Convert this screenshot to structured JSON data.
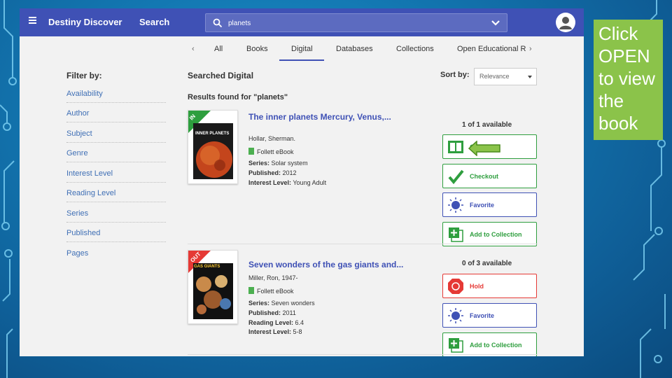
{
  "app": {
    "brand": "Destiny Discover",
    "nav_search": "Search",
    "search_value": "planets"
  },
  "tabs": [
    "All",
    "Books",
    "Digital",
    "Databases",
    "Collections",
    "Open Educational R"
  ],
  "active_tab": "Digital",
  "filter": {
    "title": "Filter by:",
    "items": [
      "Availability",
      "Author",
      "Subject",
      "Genre",
      "Interest Level",
      "Reading Level",
      "Series",
      "Published",
      "Pages"
    ]
  },
  "results": {
    "heading": "Searched Digital",
    "found": "Results found for \"planets\"",
    "sort_label": "Sort by:",
    "sort_value": "Relevance",
    "items": [
      {
        "badge": "IN",
        "cover_title": "INNER PLANETS",
        "title": "The inner planets Mercury, Venus,...",
        "author": "Hollar, Sherman.",
        "format": "Follett eBook",
        "series_label": "Series:",
        "series": "Solar system",
        "published_label": "Published:",
        "published": "2012",
        "interest_label": "Interest Level:",
        "interest": "Young Adult",
        "availability": "1 of 1 available",
        "actions": [
          "Open",
          "Checkout",
          "Favorite",
          "Add to Collection"
        ]
      },
      {
        "badge": "OUT",
        "cover_title": "GAS GIANTS",
        "title": "Seven wonders of the gas giants and...",
        "author": "Miller, Ron, 1947-",
        "format": "Follett eBook",
        "series_label": "Series:",
        "series": "Seven wonders",
        "published_label": "Published:",
        "published": "2011",
        "reading_label": "Reading Level:",
        "reading": "6.4",
        "interest_label": "Interest Level:",
        "interest": "5-8",
        "availability": "0 of 3 available",
        "actions": [
          "Hold",
          "Favorite",
          "Add to Collection"
        ]
      }
    ]
  },
  "callout": "Click OPEN to view the book",
  "colors": {
    "topbar": "#3f51b5",
    "green": "#2e9e3e",
    "red": "#e53935",
    "callout": "#8bc34a"
  }
}
